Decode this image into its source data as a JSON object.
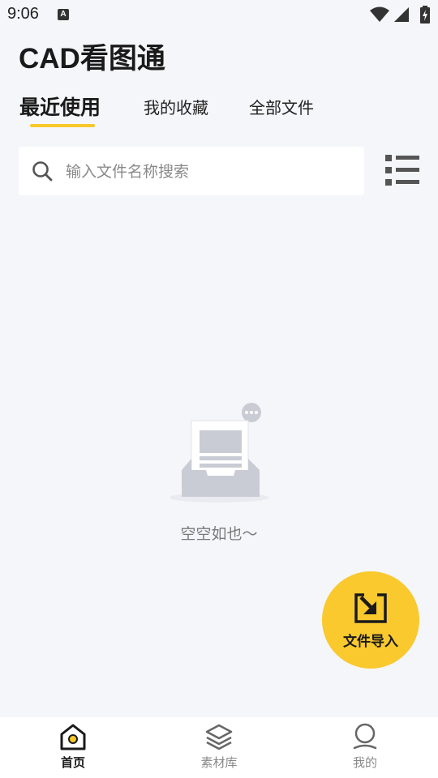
{
  "status_bar": {
    "time": "9:06",
    "notification_glyph": "A"
  },
  "app": {
    "title": "CAD看图通"
  },
  "tabs": [
    {
      "label": "最近使用",
      "active": true
    },
    {
      "label": "我的收藏",
      "active": false
    },
    {
      "label": "全部文件",
      "active": false
    }
  ],
  "search": {
    "placeholder": "输入文件名称搜索",
    "value": ""
  },
  "empty_state": {
    "message": "空空如也～"
  },
  "import_button": {
    "label": "文件导入"
  },
  "bottom_nav": [
    {
      "label": "首页",
      "icon": "home-icon",
      "active": true
    },
    {
      "label": "素材库",
      "icon": "layers-icon",
      "active": false
    },
    {
      "label": "我的",
      "icon": "profile-icon",
      "active": false
    }
  ],
  "colors": {
    "accent": "#f8c829",
    "background": "#f5f6fa",
    "fab": "#f9c92e"
  }
}
